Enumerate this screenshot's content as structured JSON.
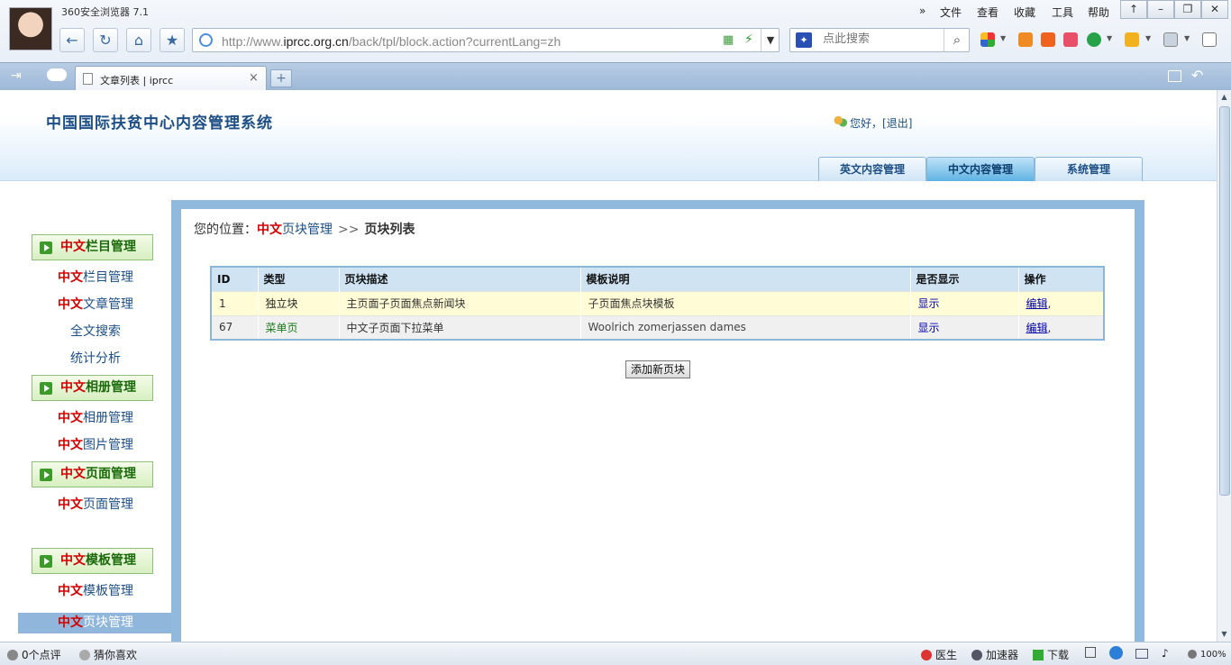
{
  "browser": {
    "app_title": "360安全浏览器 7.1",
    "url_prefix": "http://www.",
    "url_domain": "iprcc.org.cn",
    "url_path": "/back/tpl/block.action?currentLang=zh",
    "search_placeholder": "点此搜索",
    "menu": [
      "文件",
      "查看",
      "收藏",
      "工具",
      "帮助"
    ],
    "menu_more": "»",
    "tab_title": "文章列表 | iprcc",
    "tab_close": "×",
    "tab_new": "+",
    "icons": {
      "back": "arrow-left-icon",
      "refresh": "refresh-icon",
      "home": "home-icon",
      "favorite": "star-icon",
      "search": "magnifier-icon",
      "qr": "qr-code-icon",
      "accelerate": "lightning-icon"
    },
    "accent": "#1d4f86"
  },
  "header": {
    "site_title": "中国国际扶贫中心内容管理系统",
    "greeting": "您好，[",
    "logout": "退出",
    "greeting_end": "]",
    "nav_tabs": [
      {
        "label": "英文内容管理"
      },
      {
        "label": "中文内容管理"
      },
      {
        "label": "系统管理"
      }
    ]
  },
  "sidebar": {
    "prefix": "中文",
    "groups": [
      {
        "rest": "栏目管理"
      },
      {
        "rest": "相册管理"
      },
      {
        "rest": "页面管理"
      },
      {
        "rest": "模板管理"
      }
    ],
    "items": [
      {
        "rest": "栏目管理"
      },
      {
        "rest": "文章管理"
      },
      {
        "label": "全文搜索"
      },
      {
        "label": "统计分析"
      },
      {
        "rest": "相册管理"
      },
      {
        "rest": "图片管理"
      },
      {
        "rest": "页面管理"
      },
      {
        "rest": "页块管理"
      },
      {
        "rest": "模板管理"
      }
    ]
  },
  "content": {
    "breadcrumb_label": "您的位置：",
    "breadcrumb_red": "中文",
    "breadcrumb_link": "页块管理",
    "breadcrumb_sep": ">>",
    "breadcrumb_current": "页块列表",
    "table": {
      "headers": [
        "ID",
        "类型",
        "页块描述",
        "模板说明",
        "是否显示",
        "操作"
      ],
      "rows": [
        {
          "id": "1",
          "type": "独立块",
          "desc": "主页面子页面焦点新闻块",
          "template": "子页面焦点块模板",
          "show": "显示",
          "op": "编辑",
          "op_sep": ","
        },
        {
          "id": "67",
          "type": "菜单页",
          "desc": "中文子页面下拉菜单",
          "template": "Woolrich zomerjassen dames",
          "show": "显示",
          "op": "编辑",
          "op_sep": ","
        }
      ]
    },
    "add_button": "添加新页块"
  },
  "statusbar": {
    "comments": "0个点评",
    "guess": "猜你喜欢",
    "doctor": "医生",
    "accelerator": "加速器",
    "download": "下载",
    "zoom": "100%"
  }
}
